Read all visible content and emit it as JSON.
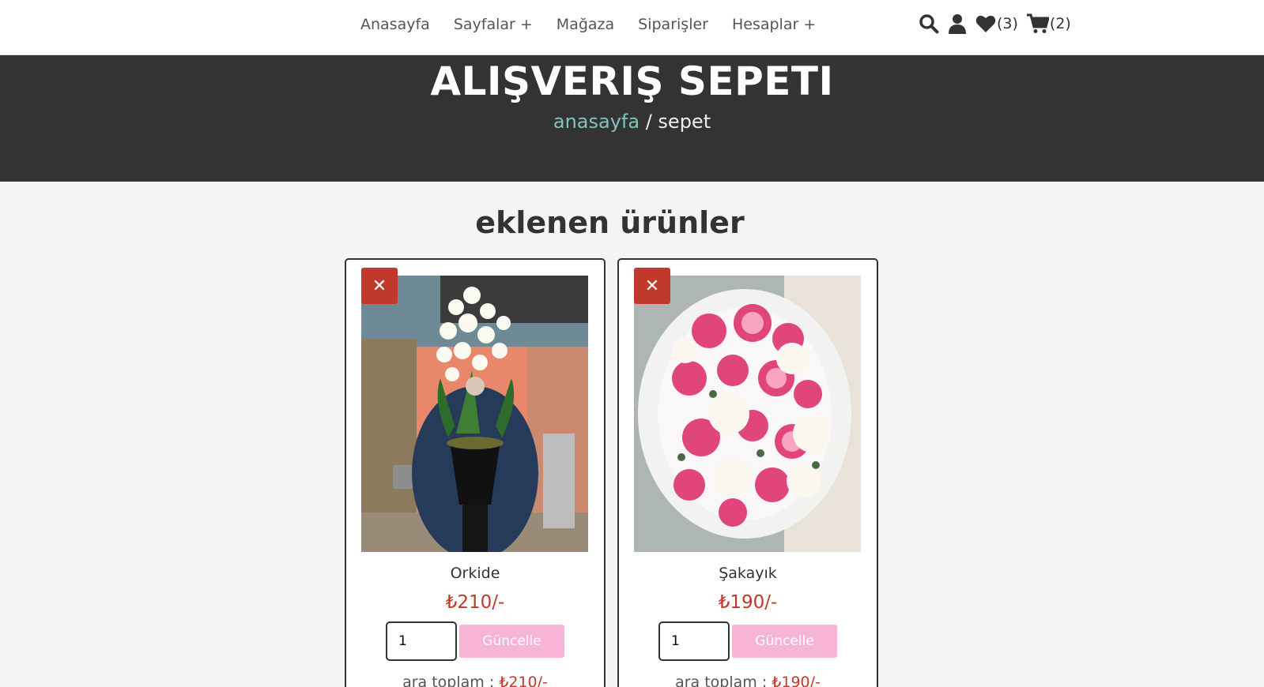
{
  "nav": {
    "items": [
      {
        "label": "Anasayfa"
      },
      {
        "label": "Sayfalar +"
      },
      {
        "label": "Mağaza"
      },
      {
        "label": "Siparişler"
      },
      {
        "label": "Hesaplar +"
      }
    ]
  },
  "header_icons": {
    "search": "search-icon",
    "user": "user-icon",
    "wishlist": {
      "icon": "heart-icon",
      "count": "(3)"
    },
    "cart": {
      "icon": "cart-icon",
      "count": "(2)"
    }
  },
  "banner": {
    "title": "ALIŞVERIŞ SEPETI",
    "breadcrumb_home": "anasayfa",
    "breadcrumb_sep": " / ",
    "breadcrumb_current": "sepet"
  },
  "section_title": "eklenen ürünler",
  "colors": {
    "accent": "#c0392b",
    "breadcrumb_link": "#7fc4bd",
    "update_button": "#f8b4d6",
    "banner_bg": "#333333"
  },
  "products": [
    {
      "remove_label": "✕",
      "name": "Orkide",
      "price": "₺210/-",
      "quantity": "1",
      "update_label": "Güncelle",
      "subtotal_label": "ara toplam : ",
      "subtotal_value": "₺210/-"
    },
    {
      "remove_label": "✕",
      "name": "Şakayık",
      "price": "₺190/-",
      "quantity": "1",
      "update_label": "Güncelle",
      "subtotal_label": "ara toplam : ",
      "subtotal_value": "₺190/-"
    }
  ]
}
